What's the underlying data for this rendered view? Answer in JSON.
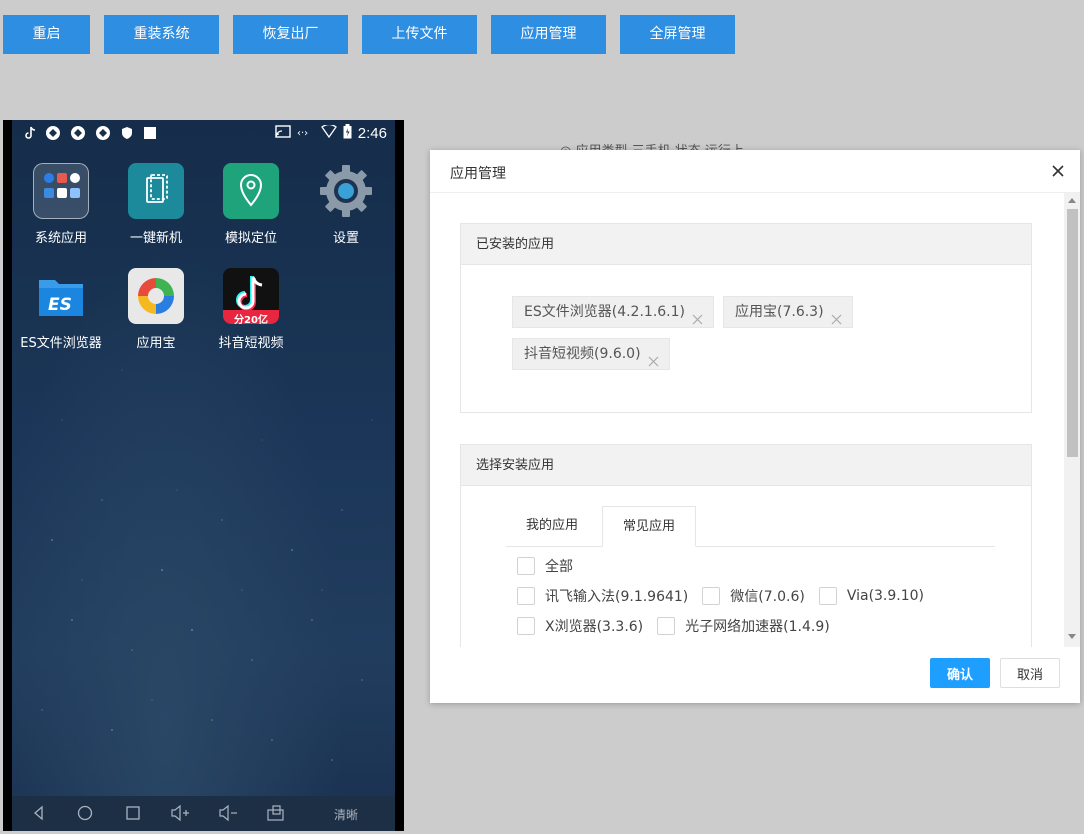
{
  "toolbar": {
    "buttons": [
      {
        "label": "重启"
      },
      {
        "label": "重装系统"
      },
      {
        "label": "恢复出厂"
      },
      {
        "label": "上传文件"
      },
      {
        "label": "应用管理"
      },
      {
        "label": "全屏管理"
      }
    ],
    "accent": "#2e8ee1"
  },
  "phone": {
    "status_bar": {
      "time": "2:46"
    },
    "apps": [
      {
        "label": "系统应用",
        "icon": "folder-icon"
      },
      {
        "label": "一键新机",
        "icon": "new-device-icon"
      },
      {
        "label": "模拟定位",
        "icon": "location-pin-icon"
      },
      {
        "label": "设置",
        "icon": "gear-icon"
      },
      {
        "label": "ES文件浏览器",
        "icon": "es-file-icon"
      },
      {
        "label": "应用宝",
        "icon": "app-store-icon"
      },
      {
        "label": "抖音短视频",
        "icon": "douyin-icon",
        "badge": "分20亿"
      }
    ],
    "nav_bar": {
      "quality_label": "清晰"
    }
  },
  "background_header": {
    "text": "◎ 应用类型    三手机      状态    运行上"
  },
  "modal": {
    "title": "应用管理",
    "installed_panel": {
      "title": "已安装的应用",
      "tags": [
        {
          "label": "ES文件浏览器(4.2.1.6.1)"
        },
        {
          "label": "应用宝(7.6.3)"
        },
        {
          "label": "抖音短视频(9.6.0)"
        }
      ]
    },
    "select_panel": {
      "title": "选择安装应用",
      "tabs": [
        {
          "label": "我的应用",
          "active": false
        },
        {
          "label": "常见应用",
          "active": true
        }
      ],
      "checkboxes": {
        "all": "全部",
        "row1": [
          "讯飞输入法(9.1.9641)",
          "微信(7.0.6)",
          "Via(3.9.10)"
        ],
        "row2": [
          "X浏览器(3.3.6)",
          "光子网络加速器(1.4.9)"
        ]
      }
    },
    "footer": {
      "confirm_label": "确认",
      "cancel_label": "取消"
    },
    "confirm_color": "#1e9fff"
  }
}
